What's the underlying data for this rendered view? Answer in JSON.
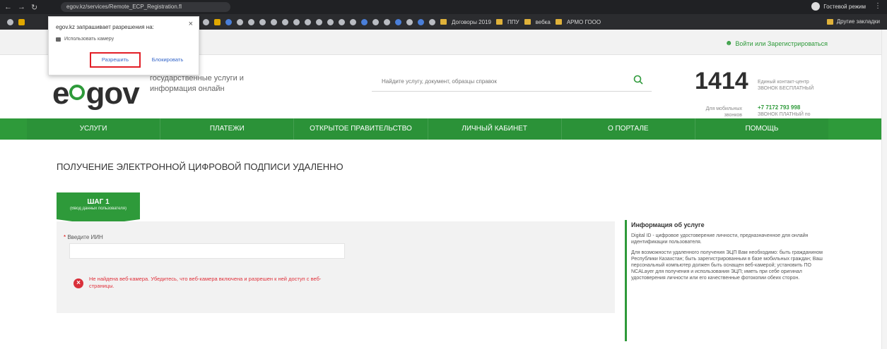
{
  "browser": {
    "address": "egov.kz/services/Remote_ECP_Registration.fl",
    "profile_label": "Гостевой режим",
    "bookmarks": [
      {
        "label": "Договоры 2019"
      },
      {
        "label": "ППУ"
      },
      {
        "label": "вебка"
      },
      {
        "label": "АРМО ГООО"
      }
    ],
    "other_bookmarks": "Другие закладки"
  },
  "permission_popup": {
    "title": "egov.kz запрашивает разрешения на:",
    "item": "Использовать камеру",
    "allow": "Разрешить",
    "block": "Блокировать"
  },
  "topbar": {
    "login": "Войти или Зарегистрироваться"
  },
  "header": {
    "logo_part1": "e",
    "logo_part2": "gov",
    "tagline": "государственные услуги и информация онлайн",
    "search_placeholder": "Найдите услугу, документ, образцы справок",
    "hotline_number": "1414",
    "hotline_desc": "Единый контакт-центр ЗВОНОК БЕСПЛАТНЫЙ",
    "mobile_label": "Для мобильных звонков",
    "phone": "+7 7172 793 998",
    "phone_desc": "ЗВОНОК ПЛАТНЫЙ по тарифу оператора"
  },
  "nav": [
    "УСЛУГИ",
    "ПЛАТЕЖИ",
    "ОТКРЫТОЕ ПРАВИТЕЛЬСТВО",
    "ЛИЧНЫЙ КАБИНЕТ",
    "О ПОРТАЛЕ",
    "ПОМОЩЬ"
  ],
  "page": {
    "title": "ПОЛУЧЕНИЕ ЭЛЕКТРОННОЙ ЦИФРОВОЙ ПОДПИСИ УДАЛЕННО",
    "step_label": "ШАГ 1",
    "step_sub": "(Ввод данных пользователя)",
    "iin_label": "Введите ИИН",
    "iin_value": "",
    "error": "Не найдена веб-камера. Убедитесь, что веб-камера включена и разрешен к ней доступ с веб-страницы."
  },
  "info": {
    "title": "Информация об услуге",
    "p1": "Digital ID - цифровое удостоверение личности, предназначенное для онлайн идентификации пользователя.",
    "p2": "Для возможности удаленного получения ЭЦП Вам необходимо: быть гражданином Республики Казахстан; быть зарегистрированным в базе мобильных граждан; Ваш персональный компьютер должен быть оснащен веб-камерой; установить ПО NCALayer для получения и использования ЭЦП; иметь при себе оригинал удостоверения личности или его качественные фотокопии обеих сторон."
  },
  "colors": {
    "brand_green": "#2e9a3a",
    "error_red": "#e0313b",
    "highlight_red": "#e21e26"
  }
}
